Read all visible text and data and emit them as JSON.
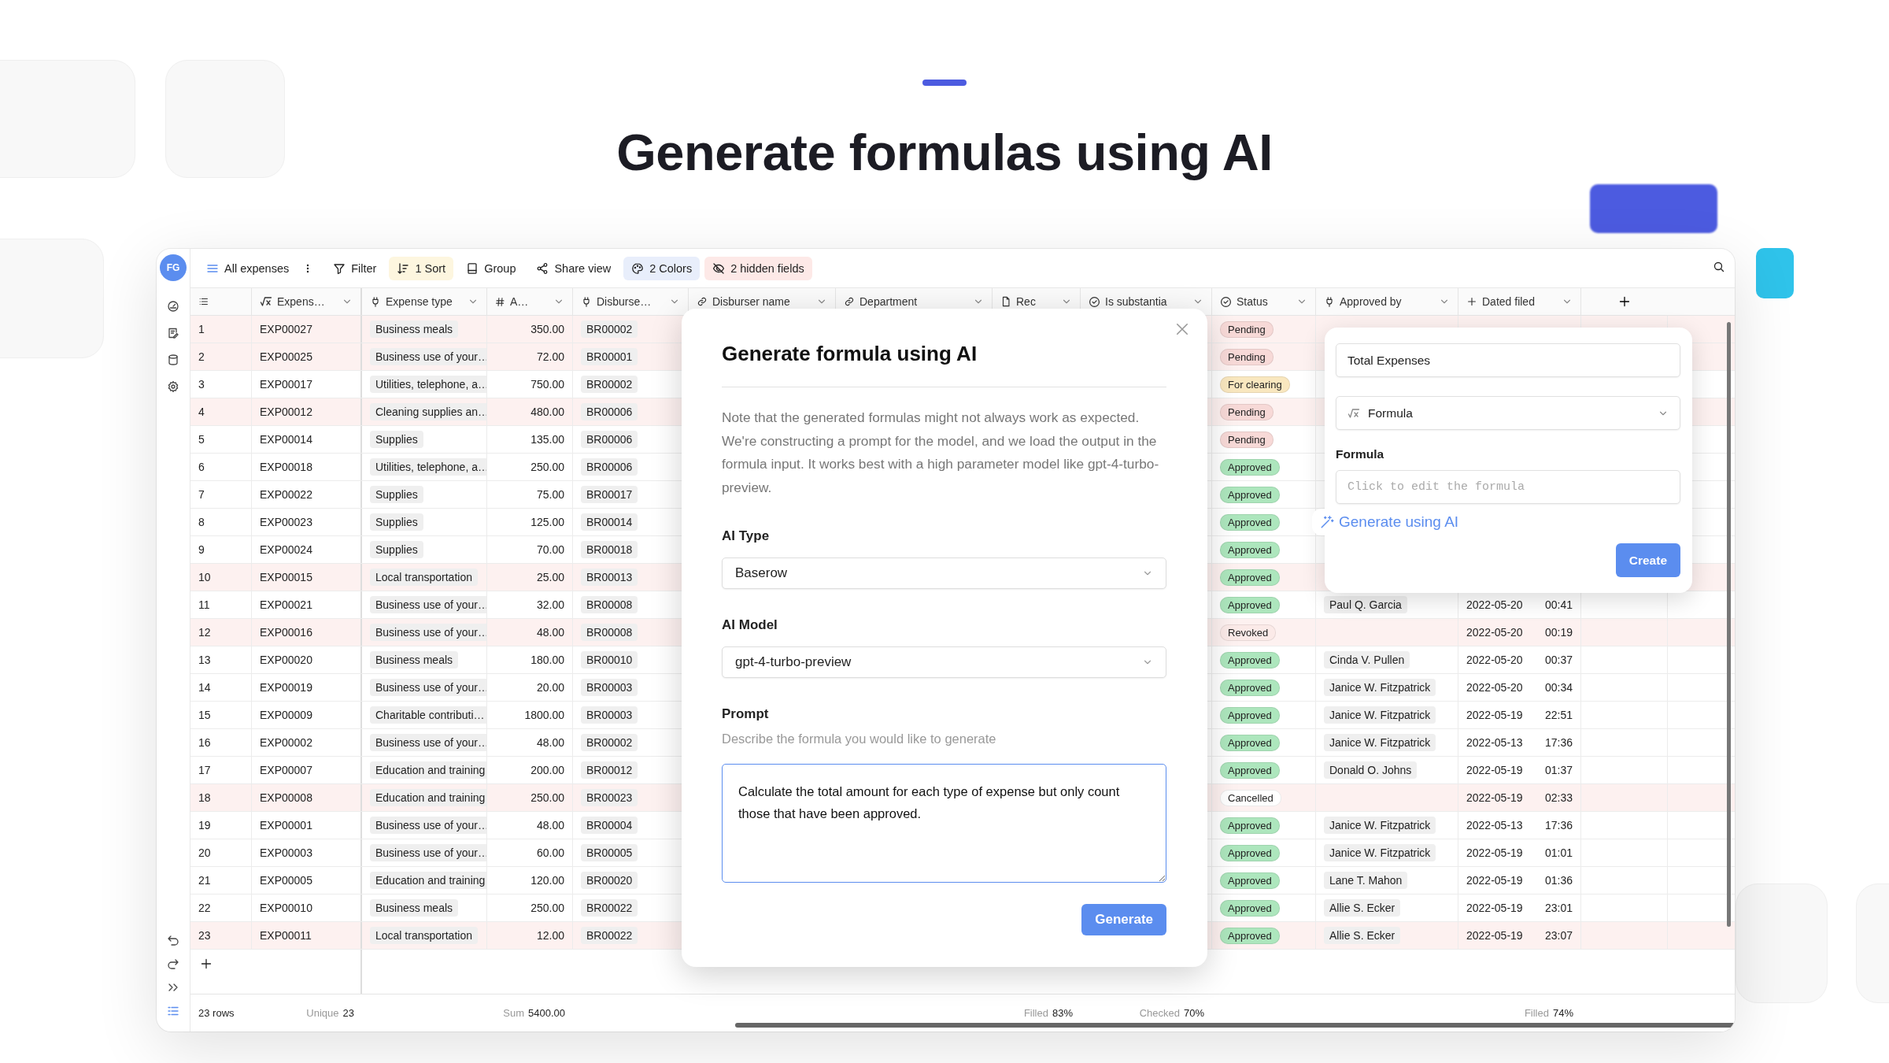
{
  "hero": {
    "title": "Generate formulas using AI"
  },
  "app": {
    "avatar": "FG",
    "toolbar": {
      "view": "All expenses",
      "buttons": [
        {
          "label": "Filter",
          "kind": "filter"
        },
        {
          "label": "1 Sort",
          "kind": "sort",
          "color": "#fdf6df"
        },
        {
          "label": "Group",
          "kind": "group"
        },
        {
          "label": "Share view",
          "kind": "share"
        },
        {
          "label": "2 Colors",
          "kind": "colors",
          "color": "#e8eefb"
        },
        {
          "label": "2 hidden fields",
          "kind": "hidden",
          "color": "#fde9e7"
        }
      ]
    },
    "columns": [
      {
        "kind": "rownum",
        "footer": {
          "value": "23 rows"
        }
      },
      {
        "name": "Expens…",
        "kind": "formula",
        "footer": {
          "label": "Unique",
          "value": "23"
        }
      },
      {
        "name": "Expense type",
        "kind": "link"
      },
      {
        "name": "A…",
        "kind": "number",
        "footer": {
          "label": "Sum",
          "value": "5400.00"
        }
      },
      {
        "name": "Disburse…",
        "kind": "link"
      },
      {
        "name": "Disburser name",
        "kind": "lookup"
      },
      {
        "name": "Department",
        "kind": "lookup"
      },
      {
        "name": "Rec",
        "kind": "file",
        "footer": {
          "label": "Filled",
          "value": "83%"
        }
      },
      {
        "name": "Is substantia",
        "kind": "boolean",
        "footer": {
          "label": "Checked",
          "value": "70%"
        }
      },
      {
        "name": "Status",
        "kind": "select"
      },
      {
        "name": "Approved by",
        "kind": "link"
      },
      {
        "name": "Dated filed",
        "kind": "created",
        "footer": {
          "label": "Filled",
          "value": "74%"
        }
      }
    ],
    "rows": [
      {
        "num": "1",
        "highlighted": true,
        "expense": "EXP00027",
        "type": "Business meals",
        "amount": "350.00",
        "disburse": "BR00002",
        "status": {
          "label": "Pending",
          "color": "#f7d9d7"
        }
      },
      {
        "num": "2",
        "highlighted": true,
        "expense": "EXP00025",
        "type": "Business use of your…",
        "amount": "72.00",
        "disburse": "BR00001",
        "status": {
          "label": "Pending",
          "color": "#f7d9d7"
        }
      },
      {
        "num": "3",
        "highlighted": false,
        "expense": "EXP00017",
        "type": "Utilities, telephone, a…",
        "amount": "750.00",
        "disburse": "BR00002",
        "status": {
          "label": "For clearing",
          "color": "#f9e7bf"
        }
      },
      {
        "num": "4",
        "highlighted": true,
        "expense": "EXP00012",
        "type": "Cleaning supplies an…",
        "amount": "480.00",
        "disburse": "BR00006",
        "status": {
          "label": "Pending",
          "color": "#f7d9d7"
        }
      },
      {
        "num": "5",
        "highlighted": false,
        "expense": "EXP00014",
        "type": "Supplies",
        "amount": "135.00",
        "disburse": "BR00006",
        "status": {
          "label": "Pending",
          "color": "#f7d9d7"
        }
      },
      {
        "num": "6",
        "highlighted": false,
        "expense": "EXP00018",
        "type": "Utilities, telephone, a…",
        "amount": "250.00",
        "disburse": "BR00006",
        "status": {
          "label": "Approved",
          "color": "#ade6bd"
        }
      },
      {
        "num": "7",
        "highlighted": false,
        "expense": "EXP00022",
        "type": "Supplies",
        "amount": "75.00",
        "disburse": "BR00017",
        "status": {
          "label": "Approved",
          "color": "#ade6bd"
        }
      },
      {
        "num": "8",
        "highlighted": false,
        "expense": "EXP00023",
        "type": "Supplies",
        "amount": "125.00",
        "disburse": "BR00014",
        "status": {
          "label": "Approved",
          "color": "#ade6bd"
        }
      },
      {
        "num": "9",
        "highlighted": false,
        "expense": "EXP00024",
        "type": "Supplies",
        "amount": "70.00",
        "disburse": "BR00018",
        "status": {
          "label": "Approved",
          "color": "#ade6bd"
        }
      },
      {
        "num": "10",
        "highlighted": true,
        "expense": "EXP00015",
        "type": "Local transportation",
        "amount": "25.00",
        "disburse": "BR00013",
        "status": {
          "label": "Approved",
          "color": "#ade6bd"
        }
      },
      {
        "num": "11",
        "highlighted": false,
        "expense": "EXP00021",
        "type": "Business use of your…",
        "amount": "32.00",
        "disburse": "BR00008",
        "status": {
          "label": "Approved",
          "color": "#ade6bd"
        },
        "approved_by": "Paul Q. Garcia",
        "date": "2022-05-20",
        "time": "00:41"
      },
      {
        "num": "12",
        "highlighted": true,
        "expense": "EXP00016",
        "type": "Business use of your…",
        "amount": "48.00",
        "disburse": "BR00008",
        "status": {
          "label": "Revoked",
          "color": "#fbeae8"
        },
        "date": "2022-05-20",
        "time": "00:19"
      },
      {
        "num": "13",
        "highlighted": false,
        "expense": "EXP00020",
        "type": "Business meals",
        "amount": "180.00",
        "disburse": "BR00010",
        "status": {
          "label": "Approved",
          "color": "#ade6bd"
        },
        "approved_by": "Cinda V. Pullen",
        "date": "2022-05-20",
        "time": "00:37"
      },
      {
        "num": "14",
        "highlighted": false,
        "expense": "EXP00019",
        "type": "Business use of your…",
        "amount": "20.00",
        "disburse": "BR00003",
        "status": {
          "label": "Approved",
          "color": "#ade6bd"
        },
        "approved_by": "Janice W. Fitzpatrick",
        "date": "2022-05-20",
        "time": "00:34"
      },
      {
        "num": "15",
        "highlighted": false,
        "expense": "EXP00009",
        "type": "Charitable contributi…",
        "amount": "1800.00",
        "disburse": "BR00003",
        "status": {
          "label": "Approved",
          "color": "#ade6bd"
        },
        "approved_by": "Janice W. Fitzpatrick",
        "date": "2022-05-19",
        "time": "22:51"
      },
      {
        "num": "16",
        "highlighted": false,
        "expense": "EXP00002",
        "type": "Business use of your…",
        "amount": "48.00",
        "disburse": "BR00002",
        "status": {
          "label": "Approved",
          "color": "#ade6bd"
        },
        "approved_by": "Janice W. Fitzpatrick",
        "date": "2022-05-13",
        "time": "17:36"
      },
      {
        "num": "17",
        "highlighted": false,
        "expense": "EXP00007",
        "type": "Education and training",
        "amount": "200.00",
        "disburse": "BR00012",
        "status": {
          "label": "Approved",
          "color": "#ade6bd"
        },
        "approved_by": "Donald O. Johns",
        "date": "2022-05-19",
        "time": "01:37"
      },
      {
        "num": "18",
        "highlighted": true,
        "expense": "EXP00008",
        "type": "Education and training",
        "amount": "250.00",
        "disburse": "BR00023",
        "status": {
          "label": "Cancelled",
          "color": "#ffffff"
        },
        "date": "2022-05-19",
        "time": "02:33"
      },
      {
        "num": "19",
        "highlighted": false,
        "expense": "EXP00001",
        "type": "Business use of your…",
        "amount": "48.00",
        "disburse": "BR00004",
        "status": {
          "label": "Approved",
          "color": "#ade6bd"
        },
        "approved_by": "Janice W. Fitzpatrick",
        "date": "2022-05-13",
        "time": "17:36"
      },
      {
        "num": "20",
        "highlighted": false,
        "expense": "EXP00003",
        "type": "Business use of your…",
        "amount": "60.00",
        "disburse": "BR00005",
        "status": {
          "label": "Approved",
          "color": "#ade6bd"
        },
        "approved_by": "Janice W. Fitzpatrick",
        "date": "2022-05-19",
        "time": "01:01"
      },
      {
        "num": "21",
        "highlighted": false,
        "expense": "EXP00005",
        "type": "Education and training",
        "amount": "120.00",
        "disburse": "BR00020",
        "status": {
          "label": "Approved",
          "color": "#ade6bd"
        },
        "approved_by": "Lane T. Mahon",
        "date": "2022-05-19",
        "time": "01:36"
      },
      {
        "num": "22",
        "highlighted": false,
        "expense": "EXP00010",
        "type": "Business meals",
        "amount": "250.00",
        "disburse": "BR00022",
        "status": {
          "label": "Approved",
          "color": "#ade6bd"
        },
        "approved_by": "Allie S. Ecker",
        "date": "2022-05-19",
        "time": "23:01"
      },
      {
        "num": "23",
        "highlighted": true,
        "expense": "EXP00011",
        "type": "Local transportation",
        "amount": "12.00",
        "disburse": "BR00022",
        "status": {
          "label": "Approved",
          "color": "#ade6bd"
        },
        "approved_by": "Allie S. Ecker",
        "date": "2022-05-19",
        "time": "23:07"
      }
    ]
  },
  "modal": {
    "title": "Generate formula using AI",
    "note": "Note that the generated formulas might not always work as expected. We're constructing a prompt for the model, and we load the output in the formula input. It works best with a high parameter model like gpt-4-turbo-preview.",
    "fields": [
      {
        "label": "AI Type",
        "value": "Baserow"
      },
      {
        "label": "AI Model",
        "value": "gpt-4-turbo-preview"
      }
    ],
    "prompt": {
      "label": "Prompt",
      "hint": "Describe the formula you would like to generate",
      "value": "Calculate the total amount for each type of expense but only count those that have been approved."
    },
    "button": "Generate"
  },
  "field_popup": {
    "name": "Total Expenses",
    "type": "Formula",
    "formula_label": "Formula",
    "formula_placeholder": "Click to edit the formula",
    "ai_link": "Generate using AI",
    "button": "Create"
  }
}
